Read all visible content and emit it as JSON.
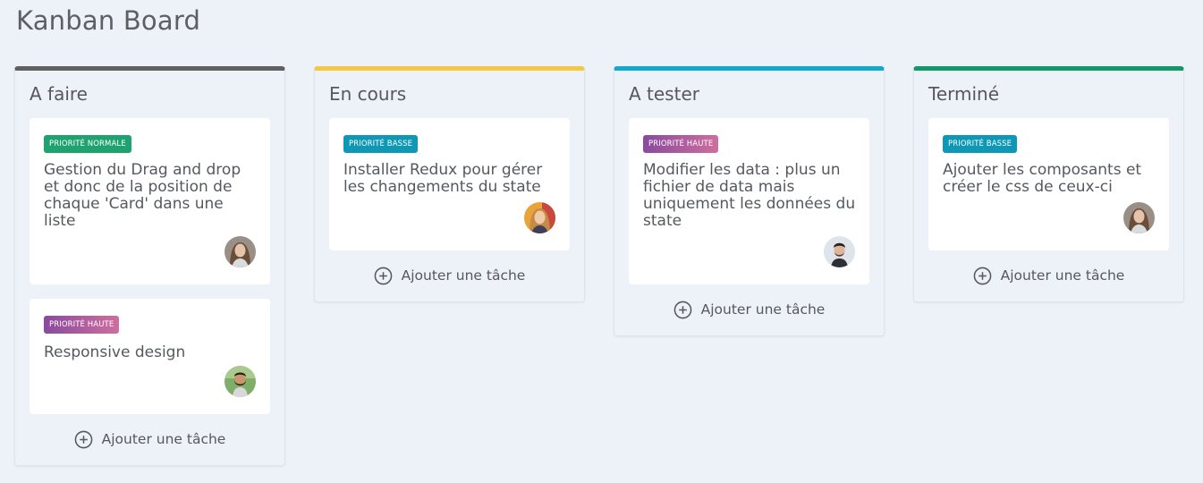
{
  "board": {
    "title": "Kanban Board"
  },
  "colors": {
    "todo": "#5f6062",
    "in_progress": "#f5c83f",
    "testing": "#12a9cc",
    "done": "#129868",
    "badge_normale": "#1ea370",
    "badge_basse": "#0e98b5",
    "badge_haute_from": "#8a4a9e",
    "badge_haute_to": "#cf6e9e"
  },
  "add_task_label": "Ajouter une tâche",
  "columns": [
    {
      "title": "A faire",
      "cards": [
        {
          "priority": "PRIORITÉ NORMALE",
          "title": "Gestion du Drag and drop et donc de la position de chaque 'Card' dans une liste",
          "avatar": "woman-avatar"
        },
        {
          "priority": "PRIORITÉ HAUTE",
          "title": "Responsive design",
          "avatar": "man-beard-avatar"
        }
      ]
    },
    {
      "title": "En cours",
      "cards": [
        {
          "priority": "PRIORITÉ BASSE",
          "title": "Installer Redux pour gérer les changements du state",
          "avatar": "woman-colorful-avatar"
        }
      ]
    },
    {
      "title": "A tester",
      "cards": [
        {
          "priority": "PRIORITÉ HAUTE",
          "title": "Modifier les data : plus un fichier de data mais uniquement les données du state",
          "avatar": "man-avatar"
        }
      ]
    },
    {
      "title": "Terminé",
      "cards": [
        {
          "priority": "PRIORITÉ BASSE",
          "title": "Ajouter les composants et créer le css de ceux-ci",
          "avatar": "woman-avatar"
        }
      ]
    }
  ]
}
